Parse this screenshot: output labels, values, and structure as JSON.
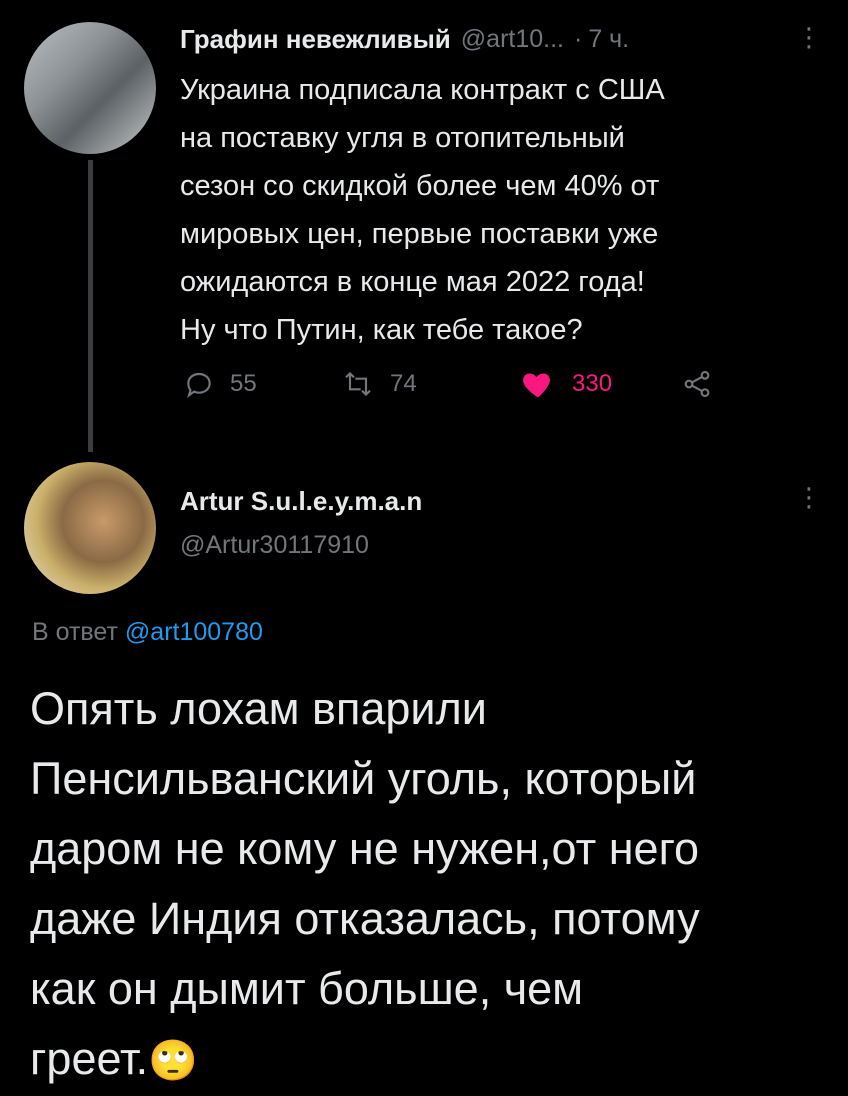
{
  "tweet1": {
    "display_name": "Графин невежливый",
    "handle": "@art10...",
    "separator": "·",
    "time": "7 ч.",
    "text": "Украина подписала контракт с США\nна поставку угля в отопительный\nсезон со скидкой более чем 40% от\nмировых цен, первые поставки уже\nожидаются в конце мая 2022 года!\nНу что Путин, как тебе такое?",
    "replies": "55",
    "retweets": "74",
    "likes": "330",
    "more": "⋮"
  },
  "tweet2": {
    "display_name": "Artur S.u.l.e.y.m.a.n",
    "handle": "@Artur30117910",
    "reply_label": "В ответ",
    "reply_handle": "@art100780",
    "text": "Опять лохам впарили\nПенсильванский уголь, который\nдаром не кому не нужен,от него\nдаже Индия отказалась, потому\nкак он дымит больше, чем\nгреет.",
    "emoji": "🙄",
    "more": "⋮"
  },
  "colors": {
    "background": "#000000",
    "text": "#e7e9ea",
    "muted": "#71767b",
    "like": "#f91880",
    "link": "#1d9bf0",
    "thread_line": "#3a3d40"
  }
}
